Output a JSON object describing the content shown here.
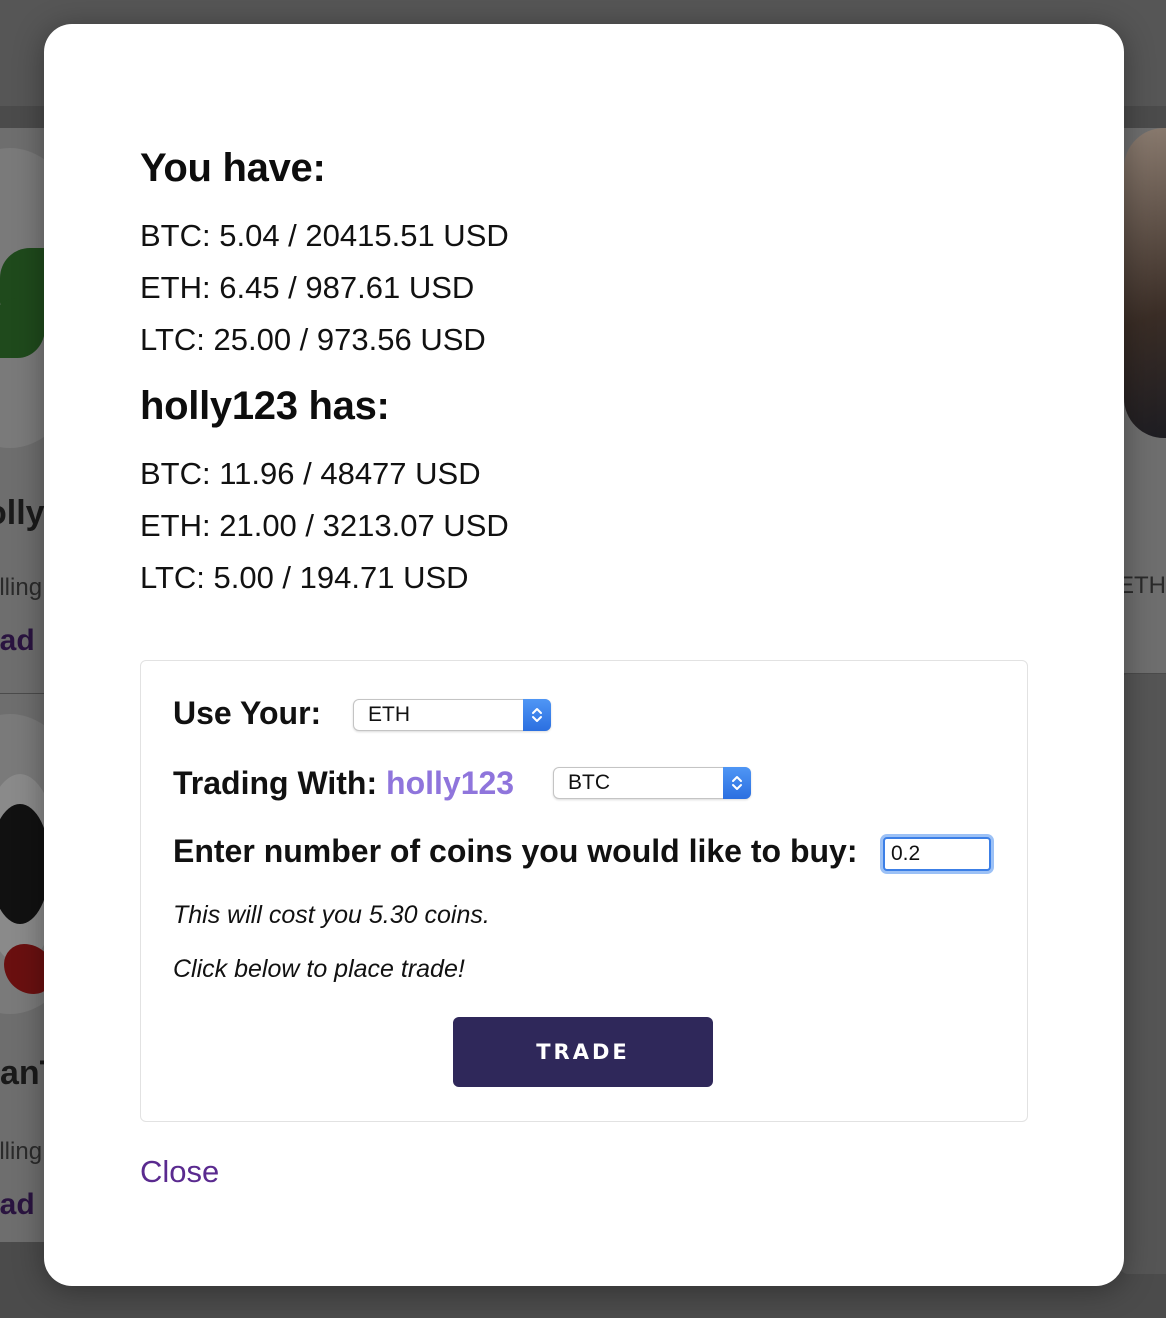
{
  "background": {
    "left_card_1": {
      "name": "olly",
      "sub": "elling",
      "link": "rad"
    },
    "left_card_2": {
      "name": "anT",
      "sub": "elling",
      "link": "rad"
    },
    "right_card_1": {
      "sub": "ETH"
    }
  },
  "modal": {
    "you_have": {
      "title": "You have:",
      "lines": [
        "BTC: 5.04 / 20415.51 USD",
        "ETH: 6.45 / 987.61 USD",
        "LTC: 25.00 / 973.56 USD"
      ]
    },
    "partner": {
      "title": "holly123 has:",
      "lines": [
        "BTC: 11.96 / 48477 USD",
        "ETH: 21.00 / 3213.07 USD",
        "LTC: 5.00 / 194.71 USD"
      ]
    },
    "trade_form": {
      "use_your_label": "Use Your:",
      "use_your_selected": "ETH",
      "trading_with_label": "Trading With:",
      "partner_name": "holly123",
      "trading_with_selected": "BTC",
      "quantity_label": "Enter number of coins you would like to buy:",
      "quantity_value": "0.2",
      "cost_note": "This will cost you 5.30 coins.",
      "instruction": "Click below to place trade!",
      "trade_button": "TRADE"
    },
    "close_link": "Close"
  },
  "colors": {
    "partner_accent": "#8f75dc",
    "button_bg": "#2f285a",
    "close_link": "#5a2a8f",
    "focus_ring": "#3c7fe6"
  }
}
